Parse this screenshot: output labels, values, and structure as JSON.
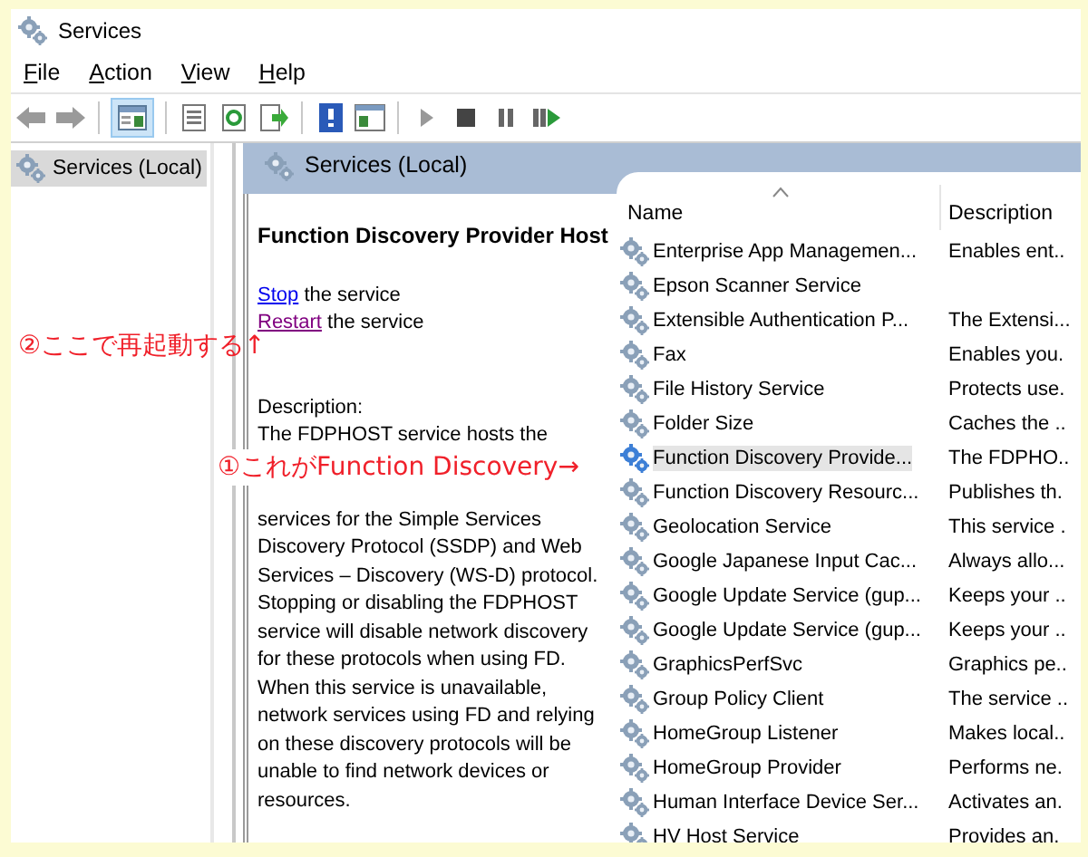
{
  "window": {
    "title": "Services"
  },
  "menu": [
    "File",
    "Action",
    "View",
    "Help"
  ],
  "toolbar": {
    "console_tree_shown": true
  },
  "tree": [
    {
      "label": "Services (Local)",
      "selected": true
    }
  ],
  "panel": {
    "title": "Services (Local)",
    "service_name": "Function Discovery Provider Host",
    "actions": [
      {
        "link": "Stop",
        "text": " the service",
        "visited": false
      },
      {
        "link": "Restart",
        "text": " the service",
        "visited": true
      }
    ],
    "description_label": "Description:",
    "description": [
      "The FDPHOST service hosts the",
      "services for the Simple Services Discovery Protocol (SSDP) and Web Services – Discovery (WS-D) protocol. Stopping or disabling the FDPHOST service will disable network discovery for these protocols when using FD. When this service is unavailable, network services using FD and relying on these discovery protocols will be unable to find network devices or resources."
    ]
  },
  "table": {
    "columns": [
      {
        "label": "Name",
        "sorted": true
      },
      {
        "label": "Description",
        "sorted": false
      }
    ],
    "rows": [
      {
        "name": "Enterprise App Managemen...",
        "description": "Enables ent..",
        "selected": false
      },
      {
        "name": "Epson Scanner Service",
        "description": "",
        "selected": false
      },
      {
        "name": "Extensible Authentication P...",
        "description": "The Extensi...",
        "selected": false
      },
      {
        "name": "Fax",
        "description": "Enables you.",
        "selected": false
      },
      {
        "name": "File History Service",
        "description": "Protects use.",
        "selected": false
      },
      {
        "name": "Folder Size",
        "description": "Caches the ..",
        "selected": false
      },
      {
        "name": "Function Discovery Provide...",
        "description": "The FDPHO..",
        "selected": true
      },
      {
        "name": "Function Discovery Resourc...",
        "description": "Publishes th.",
        "selected": false
      },
      {
        "name": "Geolocation Service",
        "description": "This service .",
        "selected": false
      },
      {
        "name": "Google Japanese Input Cac...",
        "description": "Always allo...",
        "selected": false
      },
      {
        "name": "Google Update Service (gup...",
        "description": "Keeps your ..",
        "selected": false
      },
      {
        "name": "Google Update Service (gup...",
        "description": "Keeps your ..",
        "selected": false
      },
      {
        "name": "GraphicsPerfSvc",
        "description": "Graphics pe..",
        "selected": false
      },
      {
        "name": "Group Policy Client",
        "description": "The service ..",
        "selected": false
      },
      {
        "name": "HomeGroup Listener",
        "description": "Makes local..",
        "selected": false
      },
      {
        "name": "HomeGroup Provider",
        "description": "Performs ne.",
        "selected": false
      },
      {
        "name": "Human Interface Device Ser...",
        "description": "Activates an.",
        "selected": false
      },
      {
        "name": "HV Host Service",
        "description": "Provides an.",
        "selected": false
      }
    ]
  },
  "annotations": [
    {
      "text": "②ここで再起動する↑"
    },
    {
      "text": "①これがFunction Discovery→"
    }
  ]
}
